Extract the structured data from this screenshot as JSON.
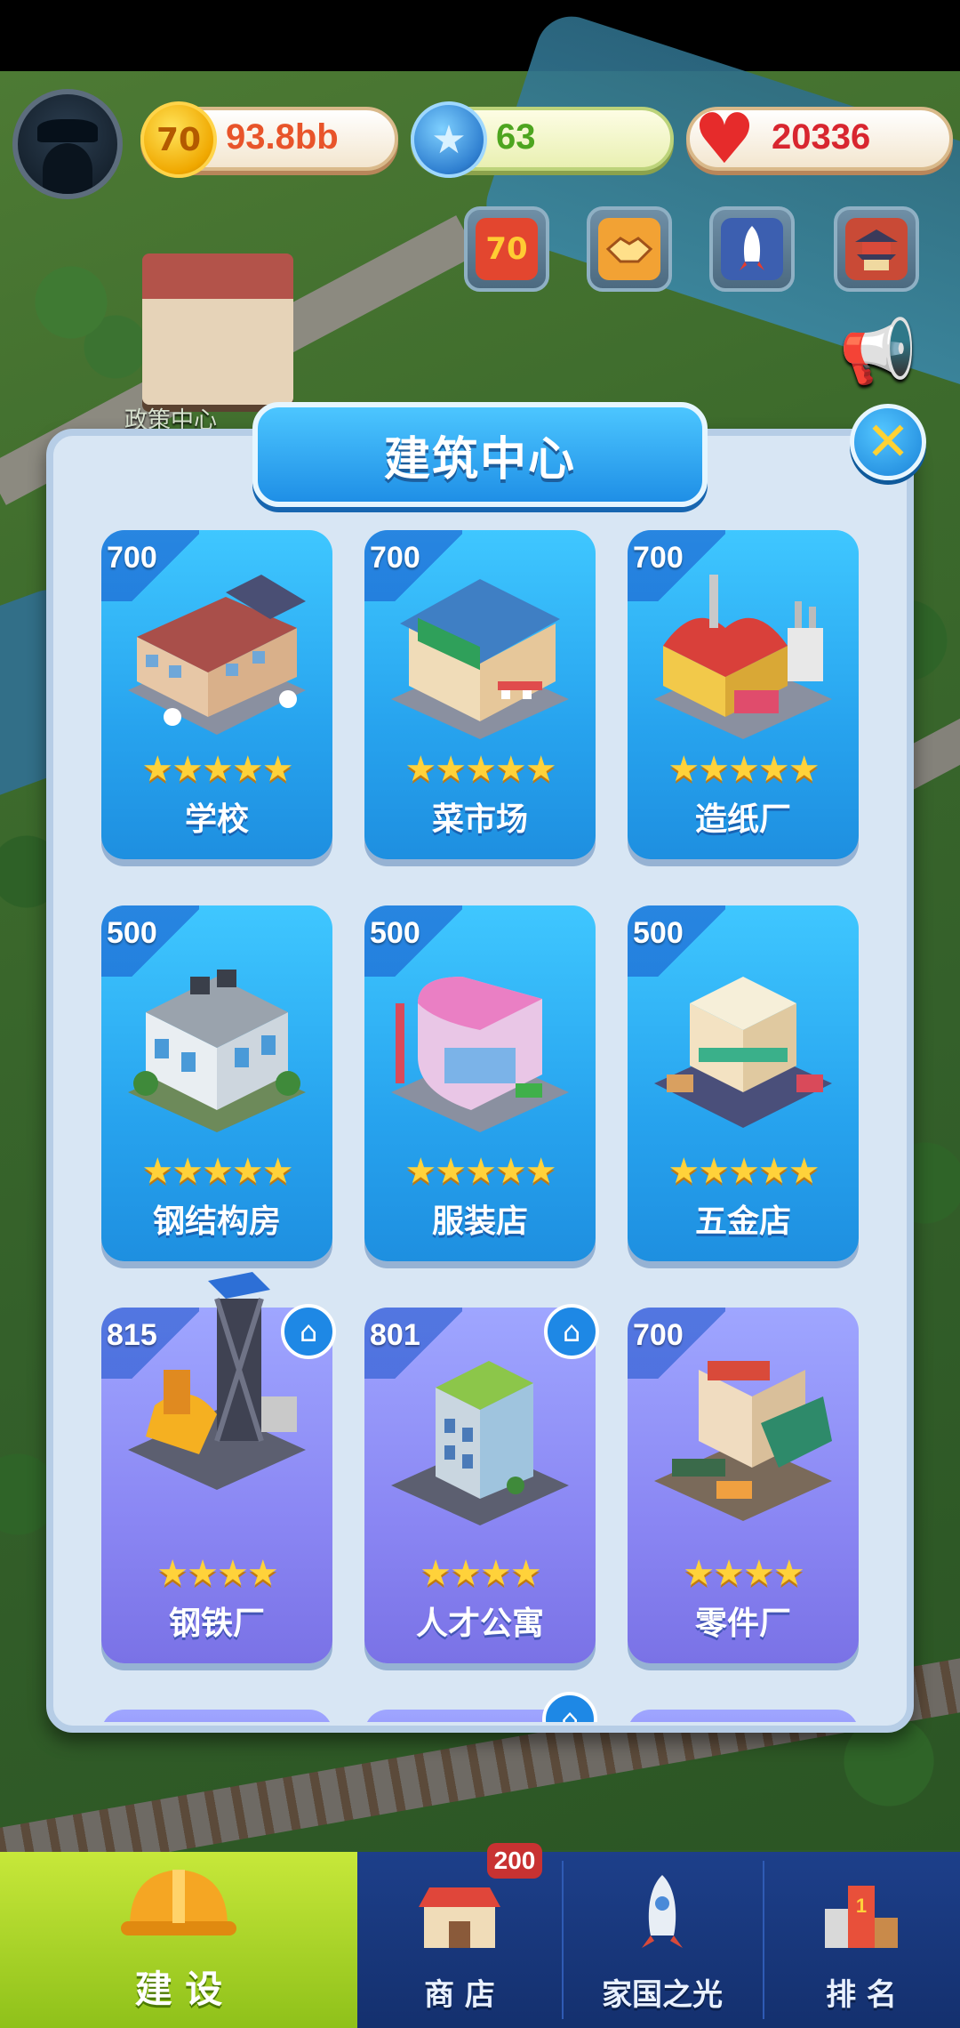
{
  "background": {
    "policy_center_label": "政策中心"
  },
  "hud": {
    "coins": "93.8bb",
    "coin_icon_text": "70",
    "stars": "63",
    "hearts": "20336",
    "quick_buttons": [
      {
        "icon": "level-70-icon",
        "text": "70"
      },
      {
        "icon": "handshake-icon"
      },
      {
        "icon": "rocket-icon"
      },
      {
        "icon": "pagoda-icon"
      }
    ],
    "speaker_icon": "speaker-icon"
  },
  "panel": {
    "title": "建筑中心",
    "close_icon": "close-icon",
    "cards": [
      {
        "price": "700",
        "name": "学校",
        "stars": "★★★★★",
        "color": "blue"
      },
      {
        "price": "700",
        "name": "菜市场",
        "stars": "★★★★★",
        "color": "blue"
      },
      {
        "price": "700",
        "name": "造纸厂",
        "stars": "★★★★★",
        "color": "blue"
      },
      {
        "price": "500",
        "name": "钢结构房",
        "stars": "★★★★★",
        "color": "blue"
      },
      {
        "price": "500",
        "name": "服装店",
        "stars": "★★★★★",
        "color": "blue"
      },
      {
        "price": "500",
        "name": "五金店",
        "stars": "★★★★★",
        "color": "blue"
      },
      {
        "price": "815",
        "name": "钢铁厂",
        "stars": "★★★★",
        "color": "purple",
        "home": true
      },
      {
        "price": "801",
        "name": "人才公寓",
        "stars": "★★★★",
        "color": "purple",
        "home": true
      },
      {
        "price": "700",
        "name": "零件厂",
        "stars": "★★★★",
        "color": "purple"
      }
    ]
  },
  "nav": {
    "items": [
      {
        "label": "建 设",
        "icon": "hardhat-icon"
      },
      {
        "label": "商 店",
        "icon": "shop-icon",
        "badge": "200"
      },
      {
        "label": "家国之光",
        "icon": "rocket-icon"
      },
      {
        "label": "排 名",
        "icon": "ranking-icon"
      }
    ]
  }
}
